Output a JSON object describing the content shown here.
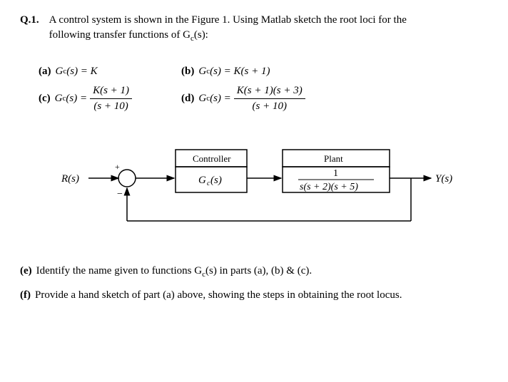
{
  "header": {
    "qnum": "Q.1.",
    "text_line1": "A control system is shown in the Figure 1.  Using Matlab sketch the root loci for the",
    "text_line2": "following transfer functions of G",
    "text_line2_sub": "c",
    "text_line2_end": "(s):"
  },
  "parts": {
    "a": {
      "label": "(a)",
      "lhs": "G",
      "sub": "c",
      "arg": "(s) = K"
    },
    "b": {
      "label": "(b)",
      "lhs": "G",
      "sub": "c",
      "arg": "(s) = K(s + 1)"
    },
    "c": {
      "label": "(c)",
      "lhs": "G",
      "sub": "c",
      "arg": "(s) =",
      "num": "K(s + 1)",
      "den": "(s + 10)"
    },
    "d": {
      "label": "(d)",
      "lhs": "G",
      "sub": "c",
      "arg": "(s) =",
      "num": "K(s + 1)(s + 3)",
      "den": "(s + 10)"
    }
  },
  "diagram": {
    "input": "R(s)",
    "output": "Y(s)",
    "controller_label": "Controller",
    "controller_tf": "Gc(s)",
    "plant_label": "Plant",
    "plant_num": "1",
    "plant_den": "s(s + 2)(s + 5)",
    "plus": "+",
    "minus": "−"
  },
  "footer": {
    "e": {
      "label": "(e)",
      "text": "Identify the name given to functions G",
      "sub": "c",
      "text2": "(s) in parts (a), (b) & (c)."
    },
    "f": {
      "label": "(f)",
      "text": "Provide a hand sketch of part (a) above, showing the steps in obtaining the root locus."
    }
  }
}
